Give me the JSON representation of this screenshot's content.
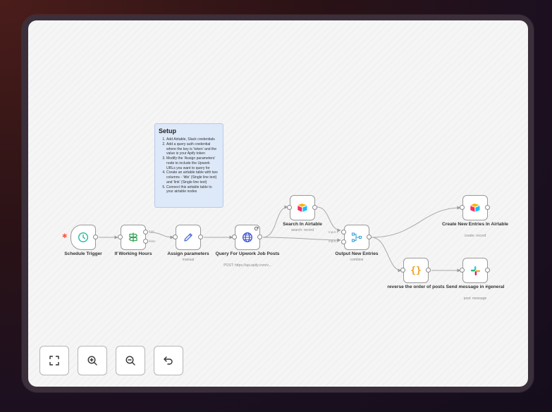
{
  "colors": {
    "accent": "#ff5a4a",
    "sticky_bg": "#dde8f8"
  },
  "note": {
    "title": "Setup",
    "items": [
      "Add Airtable, Slack credentials",
      "Add a query auth credential where the key is 'token' and the value is your Apify token",
      "Modify the 'Assign parameters' node to include the Upwork URLs you want to query for",
      "Create an airtable table with two columns - 'title' (Single line text) and 'link' (Single line text)",
      "Connect this airtable table to your airtable nodes"
    ]
  },
  "nodes": {
    "schedule": {
      "label": "Schedule Trigger",
      "icon": "clock-icon"
    },
    "hours": {
      "label": "If Working Hours",
      "icon": "signpost-icon",
      "true_label": "true",
      "false_label": "false"
    },
    "assign": {
      "label": "Assign parameters",
      "subtitle": "manual",
      "icon": "pen-icon"
    },
    "query": {
      "label": "Query For Upwork Job Posts",
      "subtitle": "POST: https://api.apify.com/v...",
      "icon": "globe-icon"
    },
    "search": {
      "label": "Search In Airtable",
      "subtitle": "search: record",
      "icon": "airtable-icon"
    },
    "merge": {
      "label": "Output New Entries",
      "subtitle": "combine",
      "icon": "merge-icon",
      "input1": "Input 1",
      "input2": "Input 2"
    },
    "create": {
      "label": "Create New Entries In Airtable",
      "subtitle": "create: record",
      "icon": "airtable-icon"
    },
    "reverse": {
      "label": "reverse the order of posts",
      "icon": "code-braces-icon",
      "glyph": "{}"
    },
    "slack": {
      "label": "Send message in #general",
      "subtitle": "post: message",
      "icon": "slack-icon"
    }
  },
  "controls": [
    {
      "name": "fit-view-button",
      "icon": "fullscreen-icon"
    },
    {
      "name": "zoom-in-button",
      "icon": "zoom-in-icon"
    },
    {
      "name": "zoom-out-button",
      "icon": "zoom-out-icon"
    },
    {
      "name": "undo-button",
      "icon": "undo-icon"
    }
  ]
}
